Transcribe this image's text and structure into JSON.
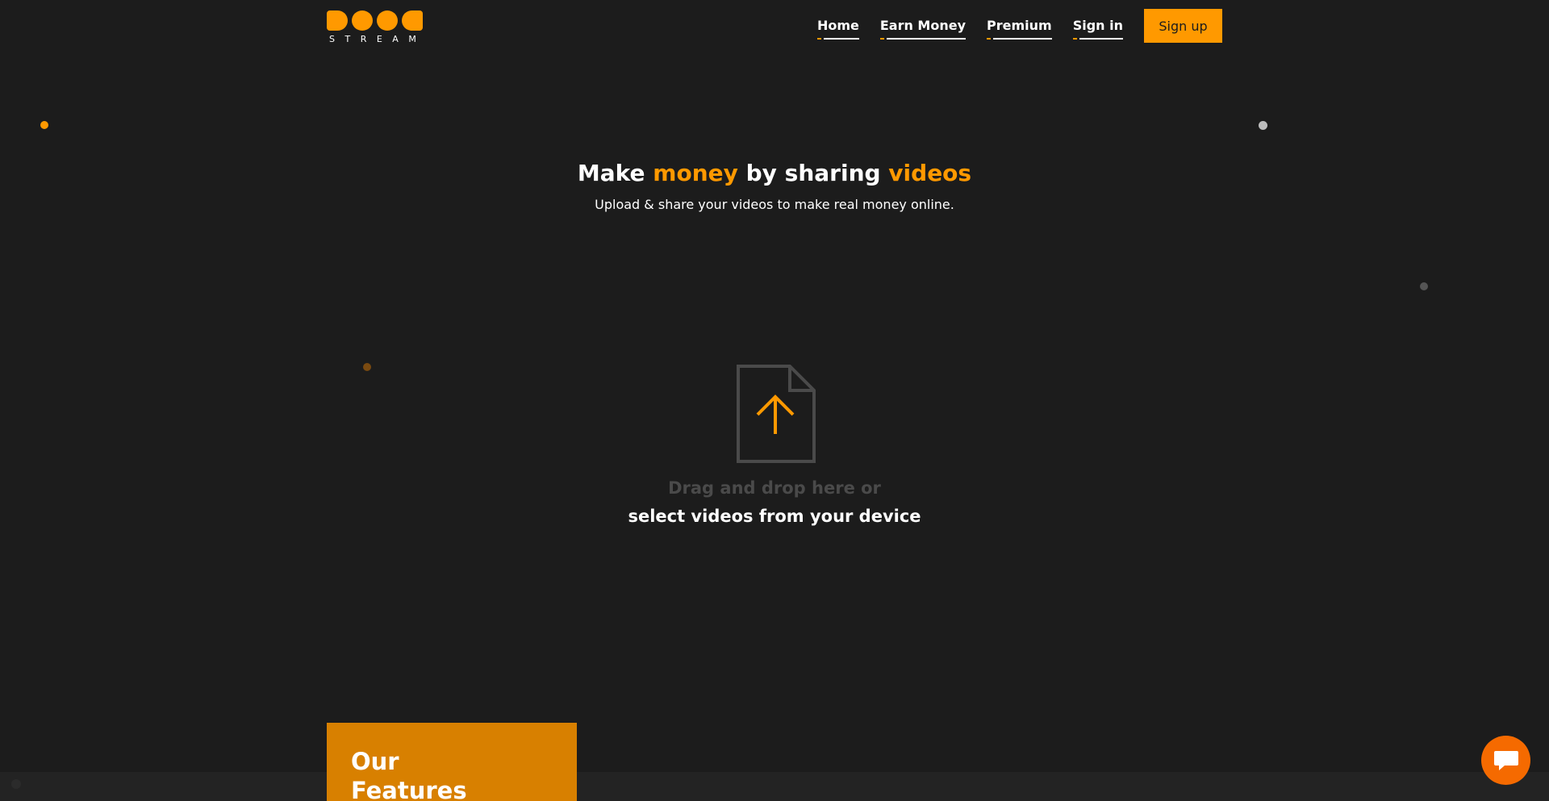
{
  "brand": {
    "logo_word": "STREAM"
  },
  "nav": {
    "items": [
      "Home",
      "Earn Money",
      "Premium",
      "Sign in"
    ],
    "signup_label": "Sign up"
  },
  "hero": {
    "title_part1": "Make ",
    "title_highlight1": "money",
    "title_part2": " by sharing ",
    "title_highlight2": "videos",
    "subtitle": "Upload & share your videos to make real money online."
  },
  "upload": {
    "icon": "file-upload-icon",
    "drag_text": "Drag and drop here or",
    "select_text": "select videos from your device"
  },
  "features": {
    "title": "Our Features"
  },
  "chat": {
    "icon": "chat-bubble-icon"
  },
  "colors": {
    "accent": "#ff9900",
    "background": "#1c1c1c",
    "chat": "#f56a00",
    "features_bg": "#d88000"
  }
}
